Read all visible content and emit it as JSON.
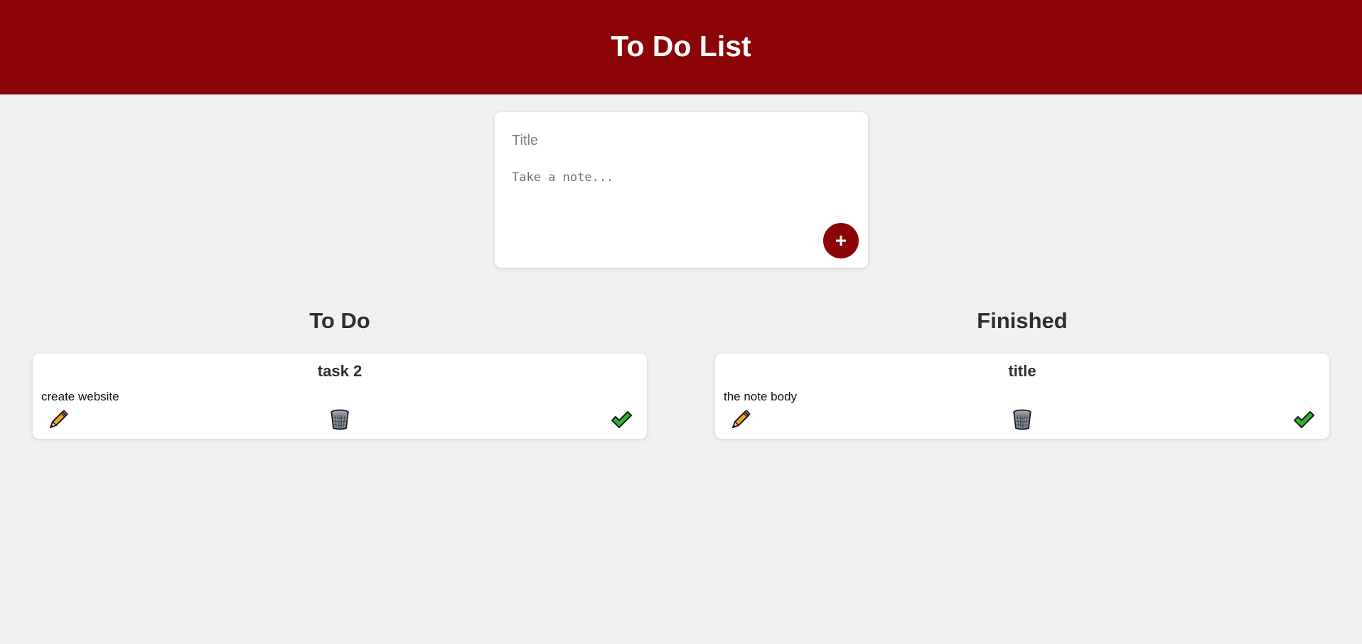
{
  "header": {
    "title": "To Do List"
  },
  "composer": {
    "title_placeholder": "Title",
    "note_placeholder": "Take a note...",
    "add_button_label": "+"
  },
  "columns": [
    {
      "heading": "To Do",
      "cards": [
        {
          "title": "task 2",
          "body": "create website",
          "actions": [
            "pencil-icon",
            "trash-icon",
            "checkmark-icon"
          ]
        }
      ]
    },
    {
      "heading": "Finished",
      "cards": [
        {
          "title": "title",
          "body": "the note body",
          "actions": [
            "pencil-icon",
            "trash-icon",
            "checkmark-icon"
          ]
        }
      ]
    }
  ],
  "colors": {
    "accent": "#8b0508",
    "background": "#f0f0f0",
    "card": "#ffffff",
    "check": "#2fb52f",
    "pencil": "#f5a623"
  }
}
